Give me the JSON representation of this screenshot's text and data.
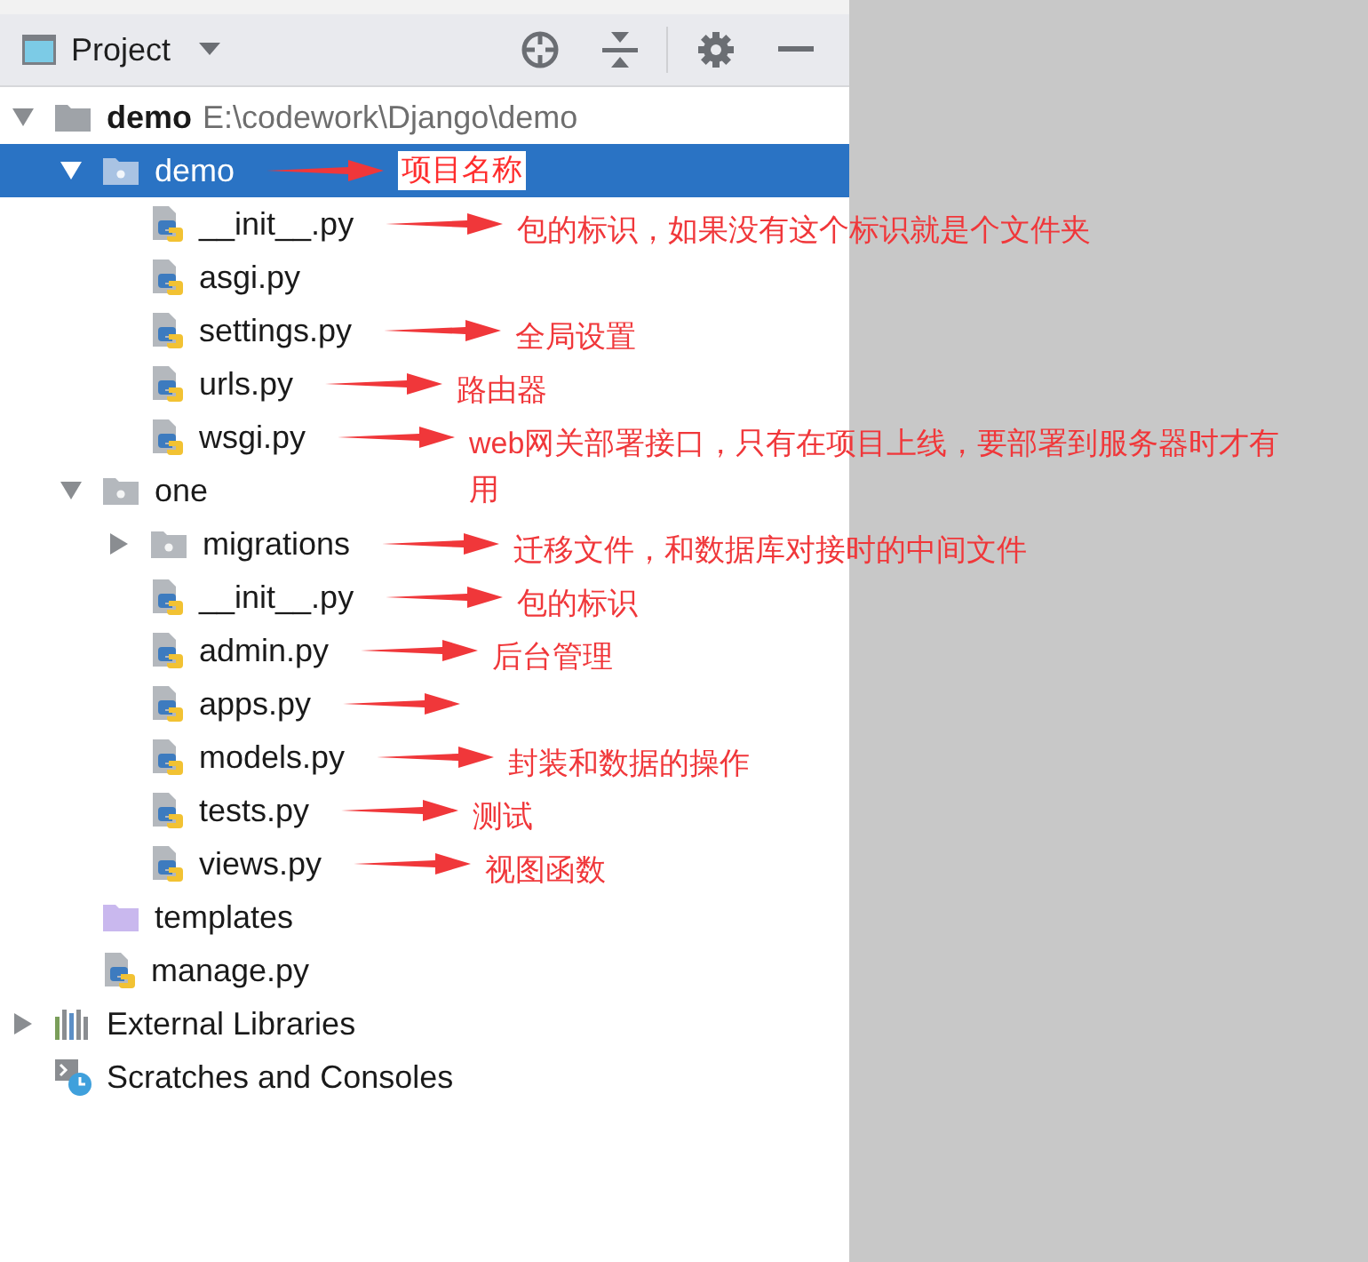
{
  "panel": {
    "title": "Project"
  },
  "tree": [
    {
      "label": "demo",
      "path": "E:\\codework\\Django\\demo",
      "kind": "root",
      "expanded": true,
      "selected": false,
      "children": [
        {
          "label": "demo",
          "kind": "package",
          "expanded": true,
          "selected": true,
          "note": "项目名称",
          "children": [
            {
              "label": "__init__.py",
              "kind": "python",
              "selected": false,
              "note": "包的标识，如果没有这个标识就是个文件夹"
            },
            {
              "label": "asgi.py",
              "kind": "python",
              "selected": false
            },
            {
              "label": "settings.py",
              "kind": "python",
              "selected": false,
              "note": "全局设置"
            },
            {
              "label": "urls.py",
              "kind": "python",
              "selected": false,
              "note": "路由器"
            },
            {
              "label": "wsgi.py",
              "kind": "python",
              "selected": false,
              "note": "web网关部署接口，只有在项目上线，要部署到服务器时才有用"
            }
          ]
        },
        {
          "label": "one",
          "kind": "package",
          "expanded": true,
          "selected": false,
          "children": [
            {
              "label": "migrations",
              "kind": "package",
              "expanded": false,
              "selected": false,
              "note": "迁移文件，和数据库对接时的中间文件"
            },
            {
              "label": "__init__.py",
              "kind": "python",
              "selected": false,
              "note": "包的标识"
            },
            {
              "label": "admin.py",
              "kind": "python",
              "selected": false,
              "note": "后台管理"
            },
            {
              "label": "apps.py",
              "kind": "python",
              "selected": false,
              "arrow": true
            },
            {
              "label": "models.py",
              "kind": "python",
              "selected": false,
              "note": "封装和数据的操作"
            },
            {
              "label": "tests.py",
              "kind": "python",
              "selected": false,
              "note": "测试"
            },
            {
              "label": "views.py",
              "kind": "python",
              "selected": false,
              "note": "视图函数"
            }
          ]
        },
        {
          "label": "templates",
          "kind": "folder",
          "selected": false
        },
        {
          "label": "manage.py",
          "kind": "python",
          "selected": false
        }
      ]
    },
    {
      "label": "External Libraries",
      "kind": "libraries",
      "expanded": false,
      "selected": false
    },
    {
      "label": "Scratches and Consoles",
      "kind": "scratches",
      "selected": false
    }
  ]
}
